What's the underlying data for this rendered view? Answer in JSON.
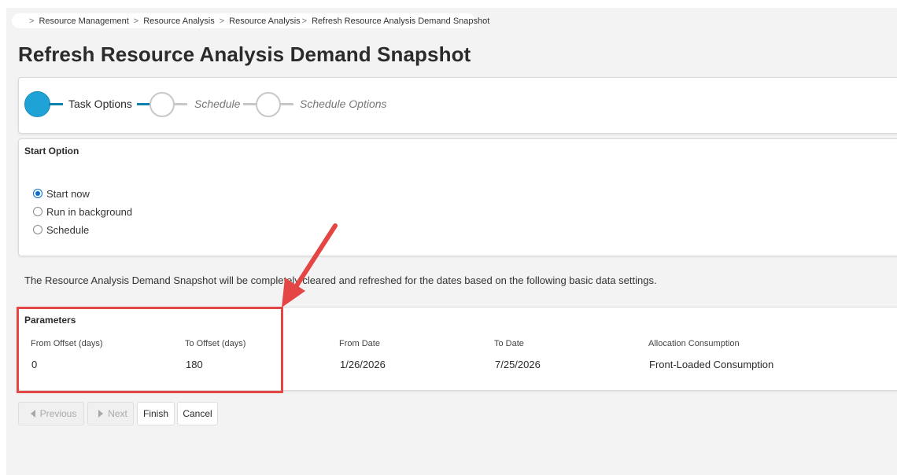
{
  "breadcrumb": {
    "items": [
      "Resource Management",
      "Resource Analysis",
      "Resource Analysis",
      "Refresh Resource Analysis Demand Snapshot"
    ],
    "separator": ">"
  },
  "page_title": "Refresh Resource Analysis Demand Snapshot",
  "wizard": {
    "steps": [
      {
        "label": "Task Options",
        "active": true
      },
      {
        "label": "Schedule",
        "active": false
      },
      {
        "label": "Schedule Options",
        "active": false
      }
    ]
  },
  "start_option": {
    "title": "Start Option",
    "options": [
      {
        "label": "Start now",
        "checked": true
      },
      {
        "label": "Run in background",
        "checked": false
      },
      {
        "label": "Schedule",
        "checked": false
      }
    ]
  },
  "info_text": "The Resource Analysis Demand Snapshot will be completely cleared and refreshed for the dates based on the following basic data settings.",
  "parameters": {
    "title": "Parameters",
    "columns": [
      {
        "label": "From Offset (days)",
        "value": "0"
      },
      {
        "label": "To Offset (days)",
        "value": "180"
      },
      {
        "label": "From Date",
        "value": "1/26/2026"
      },
      {
        "label": "To Date",
        "value": "7/25/2026"
      },
      {
        "label": "Allocation Consumption",
        "value": "Front-Loaded Consumption"
      }
    ]
  },
  "buttons": {
    "previous": "Previous",
    "next": "Next",
    "finish": "Finish",
    "cancel": "Cancel"
  },
  "colors": {
    "accent": "#1fa3d6",
    "annotation": "#e44545"
  }
}
